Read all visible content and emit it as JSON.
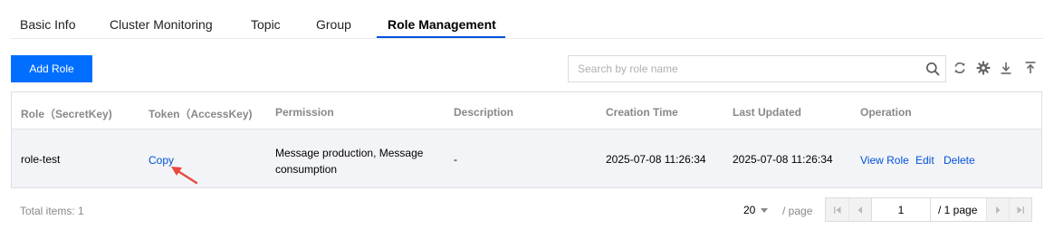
{
  "tabs": [
    {
      "label": "Basic Info"
    },
    {
      "label": "Cluster Monitoring"
    },
    {
      "label": "Topic"
    },
    {
      "label": "Group"
    },
    {
      "label": "Role Management",
      "active": true
    }
  ],
  "toolbar": {
    "add_role_label": "Add Role",
    "search_placeholder": "Search by role name",
    "icons": [
      "search-icon",
      "refresh-icon",
      "settings-icon",
      "download-icon",
      "upload-icon"
    ]
  },
  "table": {
    "headers": [
      "Role（SecretKey)",
      "Token（AccessKey)",
      "Permission",
      "Description",
      "Creation Time",
      "Last Updated",
      "Operation"
    ],
    "rows": [
      {
        "role": "role-test",
        "token": "Copy",
        "permission": "Message production, Message consumption",
        "description": "-",
        "created": "2025-07-08 11:26:34",
        "updated": "2025-07-08 11:26:34",
        "actions": [
          "View Role",
          "Edit",
          "Delete"
        ]
      }
    ]
  },
  "footer": {
    "total": "Total items:  1",
    "page_size": "20",
    "per_page": "/ page",
    "current_page": "1",
    "total_pages": "/ 1 page"
  },
  "colors": {
    "primary": "#006eff",
    "link": "#0052d9",
    "annotation_arrow": "#e84a3c"
  }
}
